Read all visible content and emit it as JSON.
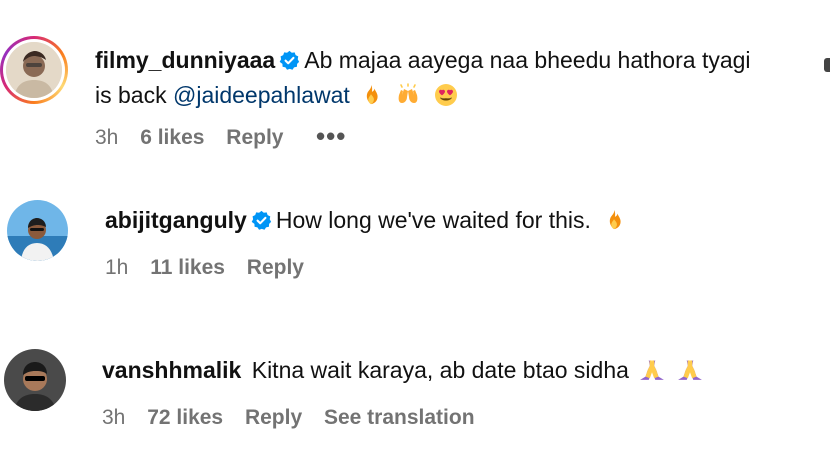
{
  "comments": [
    {
      "username": "filmy_dunniyaaa",
      "verified": true,
      "text_line1": "Ab majaa aayega naa bheedu hathora tyagi",
      "text_line2_prefix": "is back ",
      "mention": "@jaideepahlawat",
      "emojis": [
        "fire",
        "raising-hands",
        "heart-eyes"
      ],
      "time": "3h",
      "likes": "6 likes",
      "reply": "Reply",
      "more": "•••",
      "has_story_ring": true
    },
    {
      "username": "abijitganguly",
      "verified": true,
      "text": "How long we've waited for this.",
      "emojis": [
        "fire"
      ],
      "time": "1h",
      "likes": "11 likes",
      "reply": "Reply"
    },
    {
      "username": "vanshhmalik",
      "verified": false,
      "text": "Kitna wait karaya, ab date btao sidha",
      "emojis": [
        "folded-hands",
        "folded-hands"
      ],
      "time": "3h",
      "likes": "72 likes",
      "reply": "Reply",
      "translate": "See translation"
    }
  ],
  "colors": {
    "verified_badge": "#0095f6",
    "mention": "#00376b",
    "meta_text": "#737373"
  }
}
